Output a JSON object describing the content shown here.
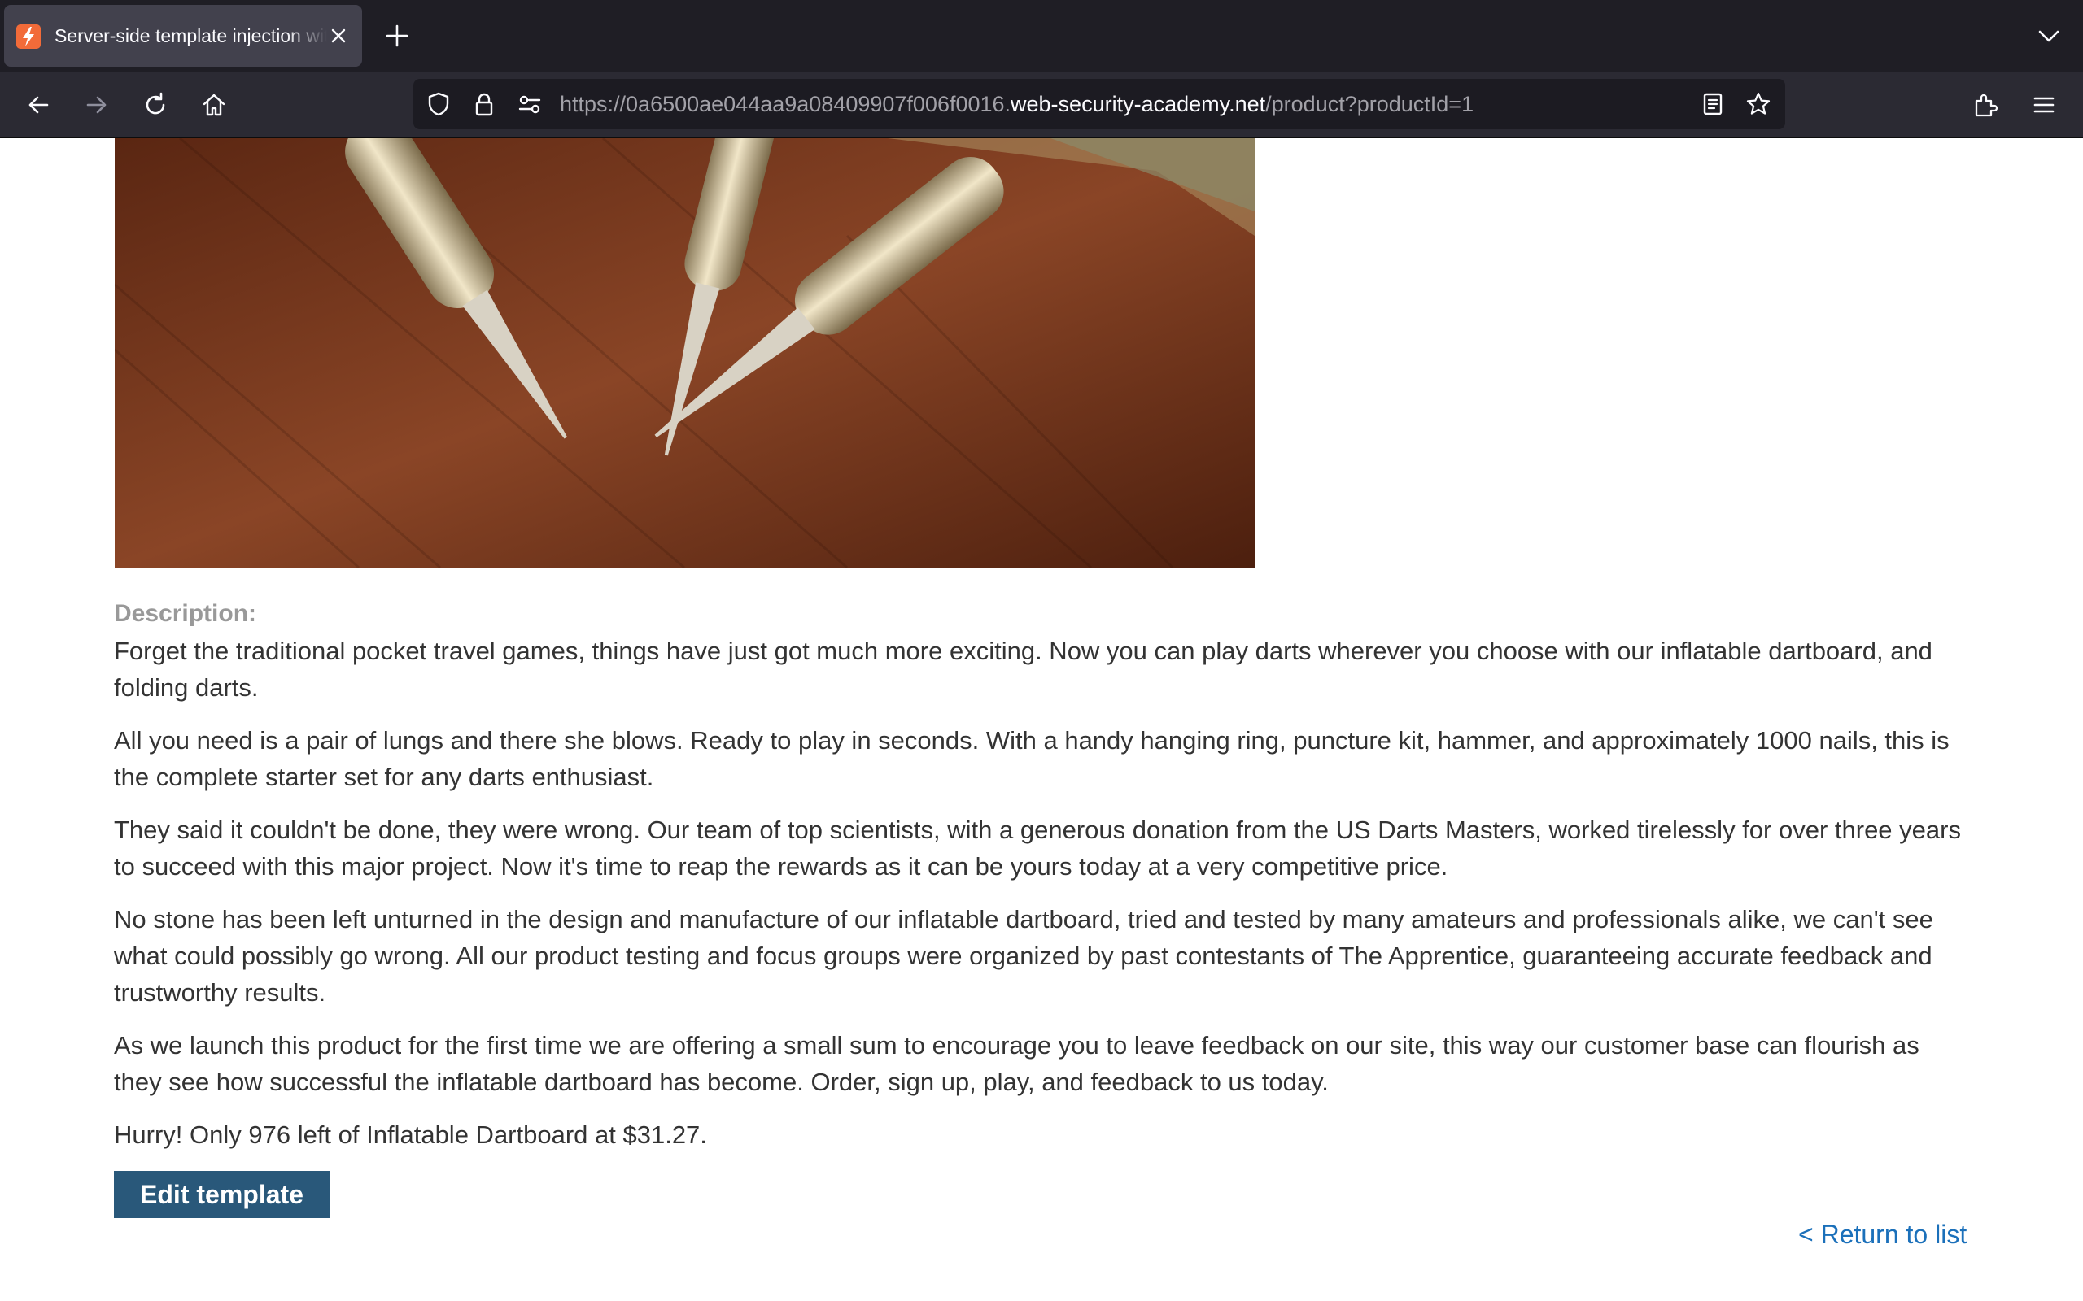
{
  "browser": {
    "tab": {
      "title": "Server-side template injection with information disclosure via user-supplied objects"
    },
    "url": {
      "prefix": "https://0a6500ae044aa9a08409907f006f0016.",
      "host": "web-security-academy.net",
      "path": "/product?productId=1"
    }
  },
  "product": {
    "description_label": "Description:",
    "paragraphs": [
      "Forget the traditional pocket travel games, things have just got much more exciting. Now you can play darts wherever you choose with our inflatable dartboard, and folding darts.",
      "All you need is a pair of lungs and there she blows. Ready to play in seconds. With a handy hanging ring, puncture kit, hammer, and approximately 1000 nails, this is the complete starter set for any darts enthusiast.",
      "They said it couldn't be done, they were wrong. Our team of top scientists, with a generous donation from the US Darts Masters, worked tirelessly for over three years to succeed with this major project. Now it's time to reap the rewards as it can be yours today at a very competitive price.",
      "No stone has been left unturned in the design and manufacture of our inflatable dartboard, tried and tested by many amateurs and professionals alike, we can't see what could possibly go wrong. All our product testing and focus groups were organized by past contestants of The Apprentice, guaranteeing accurate feedback and trustworthy results.",
      "As we launch this product for the first time we are offering a small sum to encourage you to leave feedback on our site, this way our customer base can flourish as they see how successful the inflatable dartboard has become. Order, sign up, play, and feedback to us today."
    ],
    "stock_text": "Hurry! Only 976 left of Inflatable Dartboard at $31.27."
  },
  "actions": {
    "edit_template": "Edit template",
    "return_to_list": "< Return to list"
  },
  "icons": {
    "favicon": "lab-lightning-icon",
    "back": "arrow-left-icon",
    "forward": "arrow-right-icon",
    "reload": "reload-icon",
    "home": "home-icon"
  },
  "colors": {
    "button": "#29587a",
    "link": "#1b70ba",
    "label": "#999999",
    "text": "#333333"
  }
}
